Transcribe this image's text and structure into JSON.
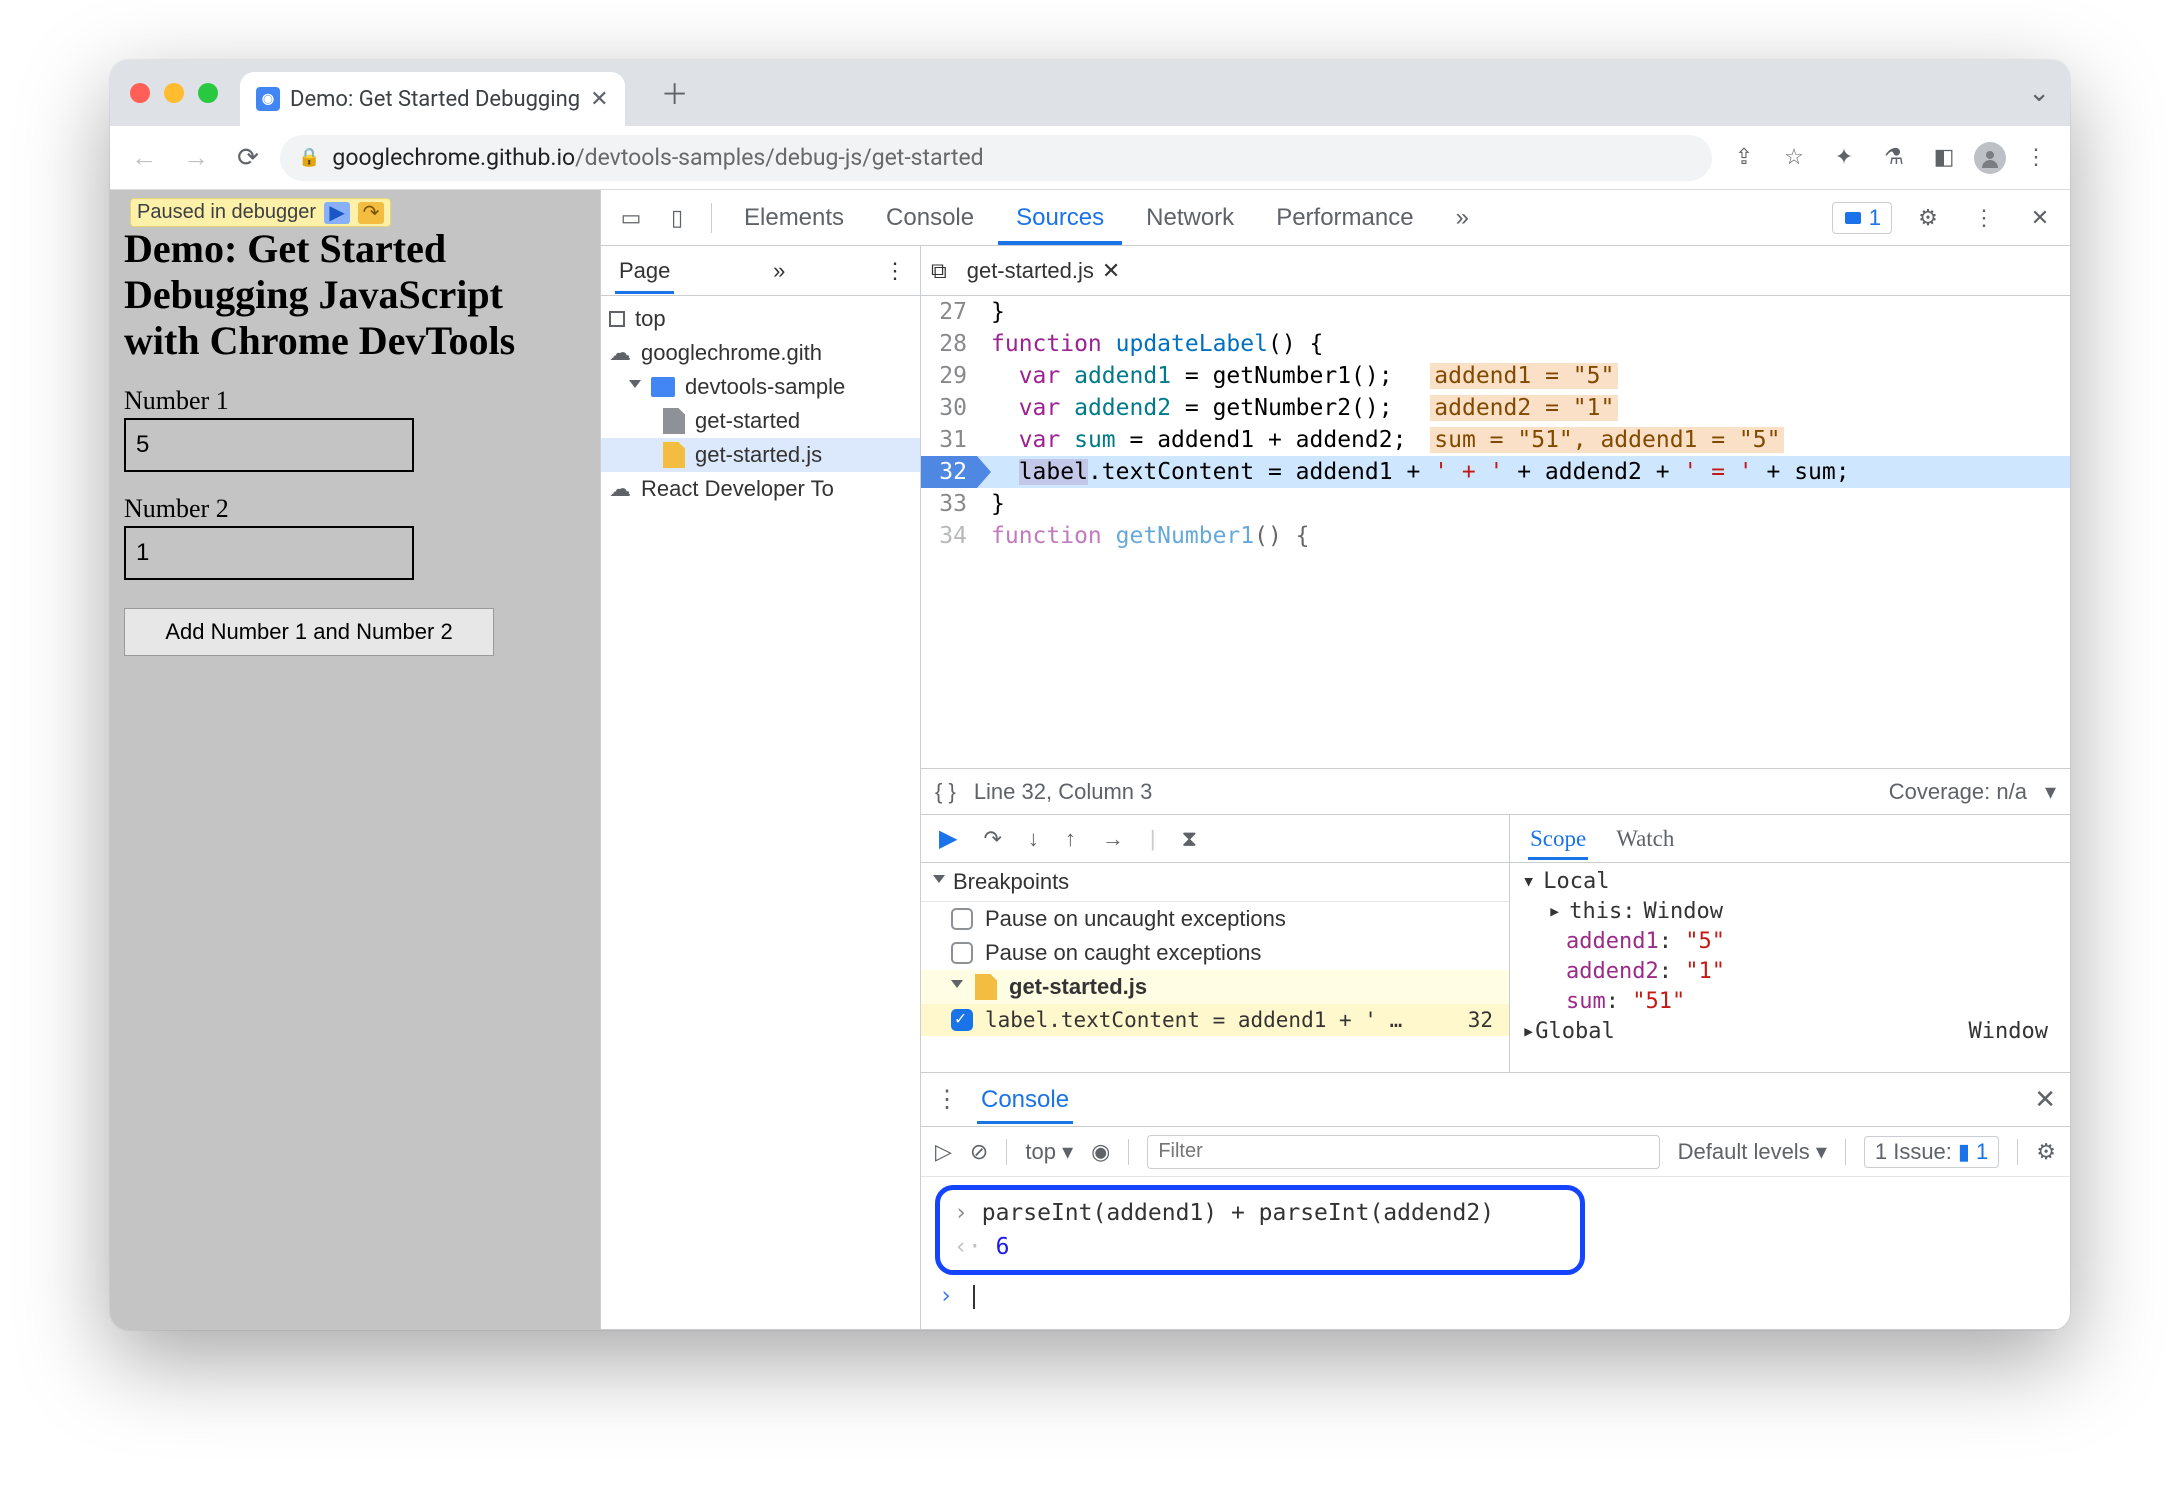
{
  "browser": {
    "tab_title": "Demo: Get Started Debugging",
    "url_host": "googlechrome.github.io",
    "url_path": "/devtools-samples/debug-js/get-started"
  },
  "paused_badge": "Paused in debugger",
  "page": {
    "heading": "Demo: Get Started Debugging JavaScript with Chrome DevTools",
    "label1": "Number 1",
    "value1": "5",
    "label2": "Number 2",
    "value2": "1",
    "button": "Add Number 1 and Number 2"
  },
  "devtools": {
    "tabs": [
      "Elements",
      "Console",
      "Sources",
      "Network",
      "Performance"
    ],
    "active_tab": "Sources",
    "more": "»",
    "issues": "1",
    "nav": {
      "page_label": "Page",
      "top": "top",
      "origin": "googlechrome.gith",
      "folder": "devtools-sample",
      "file_html": "get-started",
      "file_js": "get-started.js",
      "extension": "React Developer To"
    },
    "file_tab": "get-started.js",
    "code": {
      "lines": [
        {
          "n": 27,
          "txt": "}"
        },
        {
          "n": 28,
          "txt": "function updateLabel() {"
        },
        {
          "n": 29,
          "txt": "  var addend1 = getNumber1();",
          "hint": "addend1 = \"5\""
        },
        {
          "n": 30,
          "txt": "  var addend2 = getNumber2();",
          "hint": "addend2 = \"1\""
        },
        {
          "n": 31,
          "txt": "  var sum = addend1 + addend2;",
          "hint": "sum = \"51\", addend1 = \"5\""
        },
        {
          "n": 32,
          "txt": "  label.textContent = addend1 + ' + ' + addend2 + ' = ' + sum;",
          "exec": true
        },
        {
          "n": 33,
          "txt": "}"
        },
        {
          "n": 34,
          "txt": "function getNumber1() {"
        }
      ],
      "status": "Line 32, Column 3",
      "coverage": "Coverage: n/a"
    },
    "breakpoints": {
      "title": "Breakpoints",
      "uncaught": "Pause on uncaught exceptions",
      "caught": "Pause on caught exceptions",
      "file": "get-started.js",
      "expr": "label.textContent = addend1 + ' …",
      "line": "32"
    },
    "scope": {
      "tabs": [
        "Scope",
        "Watch"
      ],
      "local": "Local",
      "this_label": "this:",
      "this_val": "Window",
      "vars": [
        {
          "k": "addend1",
          "v": "\"5\""
        },
        {
          "k": "addend2",
          "v": "\"1\""
        },
        {
          "k": "sum",
          "v": "\"51\""
        }
      ],
      "global": "Global",
      "global_val": "Window"
    },
    "drawer": {
      "tab": "Console",
      "context": "top",
      "filter_ph": "Filter",
      "levels": "Default levels",
      "issue_label": "1 Issue:",
      "issue_count": "1",
      "input": "parseInt(addend1) + parseInt(addend2)",
      "output": "6"
    }
  }
}
